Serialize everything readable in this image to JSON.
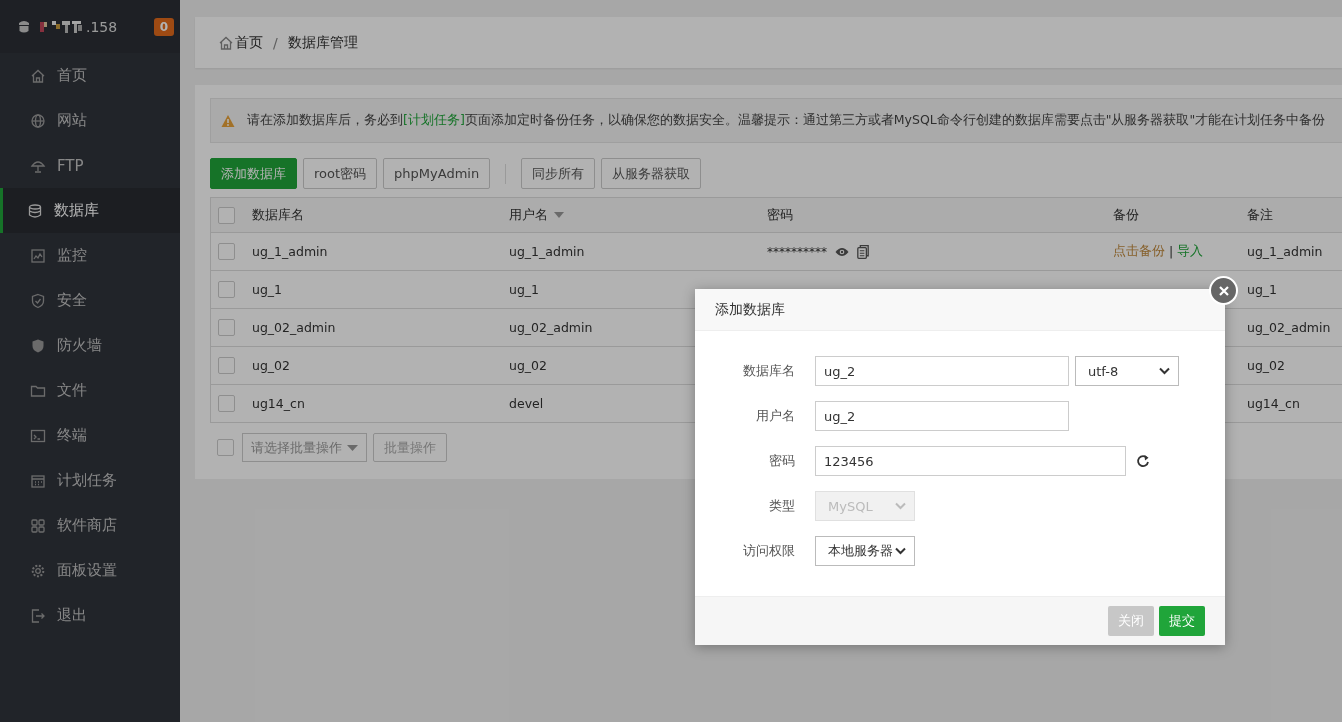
{
  "sidebar": {
    "server_name": ".158",
    "badge": "0",
    "items": [
      {
        "label": "首页",
        "selected": false
      },
      {
        "label": "网站",
        "selected": false
      },
      {
        "label": "FTP",
        "selected": false
      },
      {
        "label": "数据库",
        "selected": true
      },
      {
        "label": "监控",
        "selected": false
      },
      {
        "label": "安全",
        "selected": false
      },
      {
        "label": "防火墙",
        "selected": false
      },
      {
        "label": "文件",
        "selected": false
      },
      {
        "label": "终端",
        "selected": false
      },
      {
        "label": "计划任务",
        "selected": false
      },
      {
        "label": "软件商店",
        "selected": false
      },
      {
        "label": "面板设置",
        "selected": false
      },
      {
        "label": "退出",
        "selected": false
      }
    ]
  },
  "breadcrumb": {
    "items": [
      "首页",
      "数据库管理"
    ],
    "separator": "/"
  },
  "notice": {
    "before": "请在添加数据库后，务必到",
    "link": "[计划任务]",
    "after": "页面添加定时备份任务，以确保您的数据安全。温馨提示：通过第三方或者MySQL命令行创建的数据库需要点击\"从服务器获取\"才能在计划任务中备份"
  },
  "toolbar": {
    "groups": [
      [
        {
          "label": "添加数据库",
          "kind": "primary"
        },
        {
          "label": "root密码",
          "kind": "default"
        },
        {
          "label": "phpMyAdmin",
          "kind": "default"
        }
      ],
      [
        {
          "label": "同步所有",
          "kind": "default"
        },
        {
          "label": "从服务器获取",
          "kind": "default"
        }
      ]
    ]
  },
  "table": {
    "all_checked": false,
    "columns": [
      {
        "label": "数据库名",
        "sorted": false
      },
      {
        "label": "用户名",
        "sorted": true
      },
      {
        "label": "密码",
        "sorted": false
      },
      {
        "label": "备份",
        "sorted": false
      },
      {
        "label": "备注",
        "sorted": false
      }
    ],
    "rows": [
      {
        "checked": false,
        "name": "ug_1_admin",
        "user": "ug_1_admin",
        "password": "**********",
        "backup": {
          "links": [
            "点击备份",
            "导入"
          ],
          "separator": "|"
        },
        "note": "ug_1_admin"
      },
      {
        "checked": false,
        "name": "ug_1",
        "user": "ug_1",
        "note": "ug_1"
      },
      {
        "checked": false,
        "name": "ug_02_admin",
        "user": "ug_02_admin",
        "note": "ug_02_admin"
      },
      {
        "checked": false,
        "name": "ug_02",
        "user": "ug_02",
        "note": "ug_02"
      },
      {
        "checked": false,
        "name": "ug14_cn",
        "user": "devel",
        "note": "ug14_cn"
      }
    ]
  },
  "batch": {
    "checked": false,
    "select_placeholder": "请选择批量操作",
    "button": "批量操作",
    "disabled": true
  },
  "modal": {
    "title": "添加数据库",
    "fields": [
      {
        "kind": "text_select",
        "label": "数据库名",
        "value": "ug_2",
        "option": "utf-8",
        "disabled": false
      },
      {
        "kind": "text",
        "label": "用户名",
        "value": "ug_2",
        "disabled": false
      },
      {
        "kind": "password",
        "label": "密码",
        "value": "123456",
        "disabled": false
      },
      {
        "kind": "select",
        "label": "类型",
        "option": "MySQL",
        "disabled": true
      },
      {
        "kind": "select",
        "label": "访问权限",
        "option": "本地服务器",
        "disabled": false
      }
    ],
    "buttons": [
      {
        "label": "关闭",
        "kind": "secondary"
      },
      {
        "label": "提交",
        "kind": "primary"
      }
    ]
  }
}
